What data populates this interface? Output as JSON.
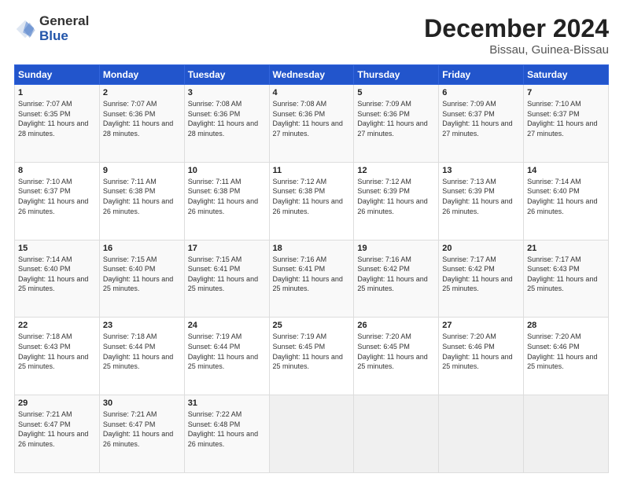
{
  "logo": {
    "general": "General",
    "blue": "Blue"
  },
  "title": "December 2024",
  "subtitle": "Bissau, Guinea-Bissau",
  "days_header": [
    "Sunday",
    "Monday",
    "Tuesday",
    "Wednesday",
    "Thursday",
    "Friday",
    "Saturday"
  ],
  "weeks": [
    [
      {
        "day": "1",
        "sunrise": "7:07 AM",
        "sunset": "6:35 PM",
        "daylight": "11 hours and 28 minutes."
      },
      {
        "day": "2",
        "sunrise": "7:07 AM",
        "sunset": "6:36 PM",
        "daylight": "11 hours and 28 minutes."
      },
      {
        "day": "3",
        "sunrise": "7:08 AM",
        "sunset": "6:36 PM",
        "daylight": "11 hours and 28 minutes."
      },
      {
        "day": "4",
        "sunrise": "7:08 AM",
        "sunset": "6:36 PM",
        "daylight": "11 hours and 27 minutes."
      },
      {
        "day": "5",
        "sunrise": "7:09 AM",
        "sunset": "6:36 PM",
        "daylight": "11 hours and 27 minutes."
      },
      {
        "day": "6",
        "sunrise": "7:09 AM",
        "sunset": "6:37 PM",
        "daylight": "11 hours and 27 minutes."
      },
      {
        "day": "7",
        "sunrise": "7:10 AM",
        "sunset": "6:37 PM",
        "daylight": "11 hours and 27 minutes."
      }
    ],
    [
      {
        "day": "8",
        "sunrise": "7:10 AM",
        "sunset": "6:37 PM",
        "daylight": "11 hours and 26 minutes."
      },
      {
        "day": "9",
        "sunrise": "7:11 AM",
        "sunset": "6:38 PM",
        "daylight": "11 hours and 26 minutes."
      },
      {
        "day": "10",
        "sunrise": "7:11 AM",
        "sunset": "6:38 PM",
        "daylight": "11 hours and 26 minutes."
      },
      {
        "day": "11",
        "sunrise": "7:12 AM",
        "sunset": "6:38 PM",
        "daylight": "11 hours and 26 minutes."
      },
      {
        "day": "12",
        "sunrise": "7:12 AM",
        "sunset": "6:39 PM",
        "daylight": "11 hours and 26 minutes."
      },
      {
        "day": "13",
        "sunrise": "7:13 AM",
        "sunset": "6:39 PM",
        "daylight": "11 hours and 26 minutes."
      },
      {
        "day": "14",
        "sunrise": "7:14 AM",
        "sunset": "6:40 PM",
        "daylight": "11 hours and 26 minutes."
      }
    ],
    [
      {
        "day": "15",
        "sunrise": "7:14 AM",
        "sunset": "6:40 PM",
        "daylight": "11 hours and 25 minutes."
      },
      {
        "day": "16",
        "sunrise": "7:15 AM",
        "sunset": "6:40 PM",
        "daylight": "11 hours and 25 minutes."
      },
      {
        "day": "17",
        "sunrise": "7:15 AM",
        "sunset": "6:41 PM",
        "daylight": "11 hours and 25 minutes."
      },
      {
        "day": "18",
        "sunrise": "7:16 AM",
        "sunset": "6:41 PM",
        "daylight": "11 hours and 25 minutes."
      },
      {
        "day": "19",
        "sunrise": "7:16 AM",
        "sunset": "6:42 PM",
        "daylight": "11 hours and 25 minutes."
      },
      {
        "day": "20",
        "sunrise": "7:17 AM",
        "sunset": "6:42 PM",
        "daylight": "11 hours and 25 minutes."
      },
      {
        "day": "21",
        "sunrise": "7:17 AM",
        "sunset": "6:43 PM",
        "daylight": "11 hours and 25 minutes."
      }
    ],
    [
      {
        "day": "22",
        "sunrise": "7:18 AM",
        "sunset": "6:43 PM",
        "daylight": "11 hours and 25 minutes."
      },
      {
        "day": "23",
        "sunrise": "7:18 AM",
        "sunset": "6:44 PM",
        "daylight": "11 hours and 25 minutes."
      },
      {
        "day": "24",
        "sunrise": "7:19 AM",
        "sunset": "6:44 PM",
        "daylight": "11 hours and 25 minutes."
      },
      {
        "day": "25",
        "sunrise": "7:19 AM",
        "sunset": "6:45 PM",
        "daylight": "11 hours and 25 minutes."
      },
      {
        "day": "26",
        "sunrise": "7:20 AM",
        "sunset": "6:45 PM",
        "daylight": "11 hours and 25 minutes."
      },
      {
        "day": "27",
        "sunrise": "7:20 AM",
        "sunset": "6:46 PM",
        "daylight": "11 hours and 25 minutes."
      },
      {
        "day": "28",
        "sunrise": "7:20 AM",
        "sunset": "6:46 PM",
        "daylight": "11 hours and 25 minutes."
      }
    ],
    [
      {
        "day": "29",
        "sunrise": "7:21 AM",
        "sunset": "6:47 PM",
        "daylight": "11 hours and 26 minutes."
      },
      {
        "day": "30",
        "sunrise": "7:21 AM",
        "sunset": "6:47 PM",
        "daylight": "11 hours and 26 minutes."
      },
      {
        "day": "31",
        "sunrise": "7:22 AM",
        "sunset": "6:48 PM",
        "daylight": "11 hours and 26 minutes."
      },
      null,
      null,
      null,
      null
    ]
  ]
}
